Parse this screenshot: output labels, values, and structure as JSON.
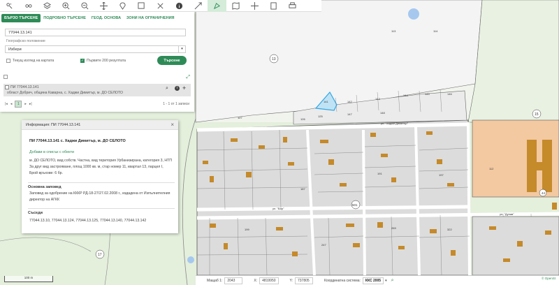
{
  "toolbar": {
    "icons": [
      "zoom-in-icon",
      "zoom-out-icon",
      "layers-icon",
      "zoom-plus-icon",
      "zoom-minus-icon",
      "pan-icon",
      "location-pin-icon",
      "select-box-icon",
      "clear-icon",
      "info-icon",
      "measure-icon",
      "map-icon",
      "crosshair-icon",
      "document-icon",
      "print-icon"
    ]
  },
  "search_panel": {
    "tabs": [
      "БЪРЗО ТЪРСЕНЕ",
      "ПОДРОБНО ТЪРСЕНЕ",
      "ГЕОД. ОСНОВА",
      "ЗОНИ НА ОГРАНИЧЕНИЯ"
    ],
    "query_value": "77044.13.141",
    "geo_label": "Географско положение",
    "geo_value": "Избери",
    "current_view_label": "Текущ изглед на картата",
    "first200_label": "Първите 200 резултата",
    "search_button": "Търсене",
    "result_title": "ПИ 77044.13.141",
    "result_subtitle": "област Добрич, община Каварна, с. Хаджи Димитър, м. ДО СЕЛОТО",
    "pager_page": "1",
    "pager_info": "1 - 1 от 1 записи"
  },
  "popup": {
    "header": "Информация: ПИ 77044.13.141",
    "title": "ПИ 77044.13.141 с. Хаджи Димитър, м. ДО СЕЛОТО",
    "add_link": "Добави в списък с обекти",
    "description": "м. ДО СЕЛОТО, вид собств. Частна, вид територия Урбанизирана, категория 3, НТП За друг вид застрояване, площ 1000 кв. м, стар номер 11, квартал 13, парцел I, Брой връхове: 6 бр.",
    "order_title": "Основна заповед",
    "order_text": "Заповед за одобрение на КККР РД-18-27/27.02.2008 г., издадена от Изпълнителния директор на АГКК",
    "neighbors_title": "Съседи",
    "neighbors_text": "77044.13.10, 77044.13.124, 77044.13.125, 77044.13.140, 77044.13.142"
  },
  "status_bar": {
    "scale_label": "Мащаб 1:",
    "scale_value": "2043",
    "x_label": "X:",
    "x_value": "4819950",
    "y_label": "Y:",
    "y_value": "737805",
    "crs_label": "Координатна система:",
    "crs_value": "ККС 2005"
  },
  "scale_bar": "100 m",
  "attribution": "© OpenSt",
  "map_labels": {
    "q13": "13",
    "q15": "15",
    "q17": "17",
    "q501": "501",
    "p44": "44",
    "streets": [
      "ул. \"Хаджи Димитър\"",
      "ул. \"Бор\"",
      "ул. \"Дунав\""
    ],
    "parcels": [
      "141",
      "142",
      "143",
      "144",
      "145",
      "146",
      "147",
      "148",
      "125",
      "126",
      "127",
      "112",
      "113",
      "114",
      "187",
      "191",
      "197",
      "199",
      "247",
      "269",
      "322"
    ]
  },
  "colors": {
    "accent": "#2e8b57",
    "parcel_fill": "#dfdfdf",
    "building": "#c58a2a",
    "highlight": "#2ea6e6",
    "orange_zone": "#f3c9a2"
  }
}
